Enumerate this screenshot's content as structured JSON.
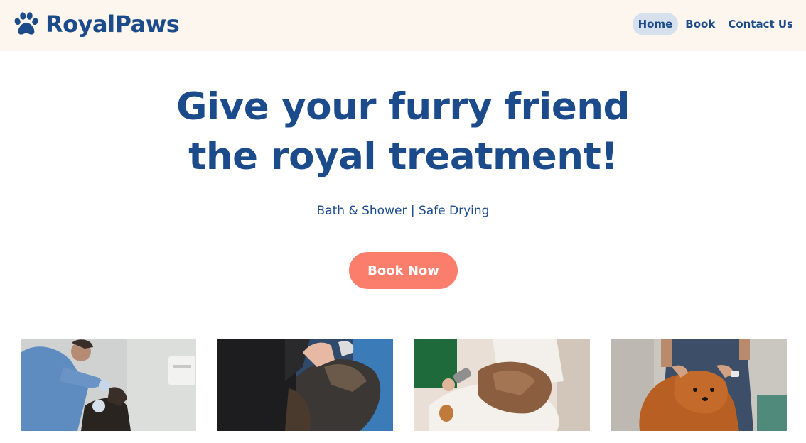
{
  "brand": {
    "name": "RoyalPaws",
    "logo_icon": "paw-print-icon",
    "color": "#1c4b8b"
  },
  "nav": {
    "items": [
      {
        "label": "Home",
        "active": true
      },
      {
        "label": "Book",
        "active": false
      },
      {
        "label": "Contact Us",
        "active": false
      }
    ]
  },
  "hero": {
    "title_line1": "Give your furry friend",
    "title_line2": "the royal treatment!",
    "subtitle": "Bath & Shower | Safe Drying",
    "cta_label": "Book Now",
    "cta_color": "#fb7e6c"
  },
  "gallery": {
    "images": [
      {
        "name": "groomer-cleaning-dog-photo"
      },
      {
        "name": "hands-brushing-dog-photo"
      },
      {
        "name": "blow-drying-dog-photo"
      },
      {
        "name": "pomeranian-dog-photo"
      }
    ]
  },
  "colors": {
    "header_bg": "#fdf6ee",
    "nav_active_bg": "#d7e1ee"
  }
}
